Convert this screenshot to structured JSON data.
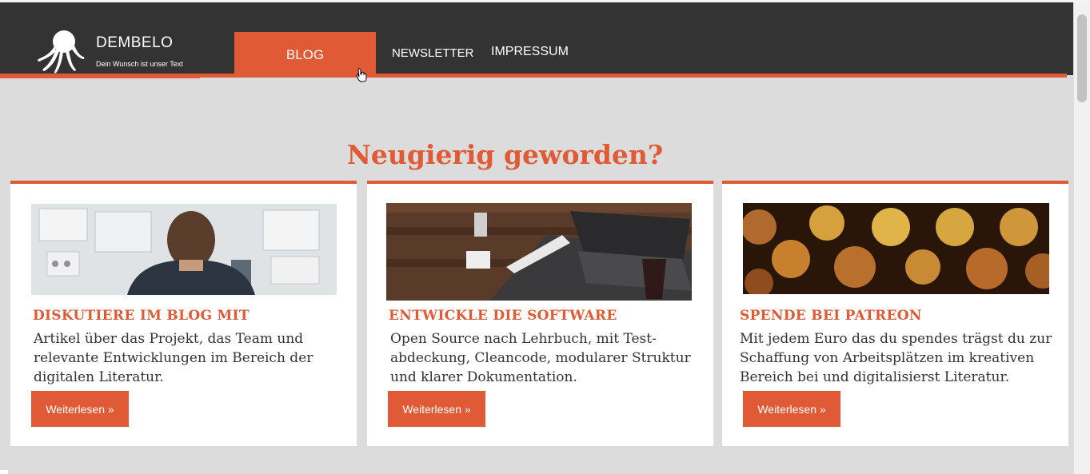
{
  "brand": {
    "name": "DEMBELO",
    "tagline": "Dein Wunsch ist unser Text"
  },
  "nav": {
    "items": [
      "BLOG",
      "NEWSLETTER",
      "IMPRESSUM"
    ],
    "active": "BLOG"
  },
  "headline": "Neugierig geworden?",
  "cards": [
    {
      "title": "DISKUTIERE IM BLOG MIT",
      "text": "Artikel über das Projekt, das Team und relevante Entwicklungen im Bereich der digitalen Literatur.",
      "button": "Weiterlesen »",
      "image": "office-whiteboard-image"
    },
    {
      "title": "ENTWICKLE DIE SOFTWARE",
      "text": "Open Source nach Lehrbuch, mit Test-abdeckung, Cleancode, modularer Struktur und klarer Dokumentation.",
      "button": "Weiterlesen »",
      "image": "laptops-table-image"
    },
    {
      "title": "SPENDE BEI PATREON",
      "text": "Mit jedem Euro das du spendes trägst du zur Schaffung von Arbeitsplätzen im kreativen Bereich bei und digitalisierst Literatur.",
      "button": "Weiterlesen »",
      "image": "coins-image"
    }
  ],
  "colors": {
    "accent": "#e05a36",
    "header_bg": "#333333",
    "page_bg": "#dcdcdc",
    "card_bg": "#ffffff"
  }
}
